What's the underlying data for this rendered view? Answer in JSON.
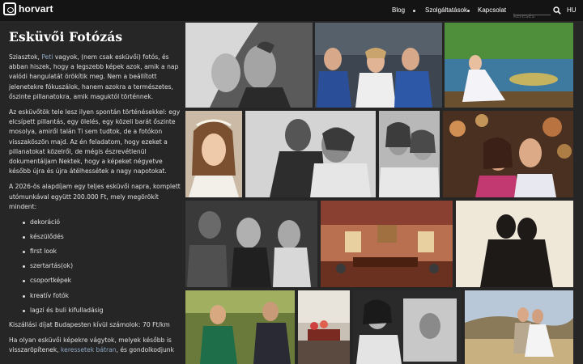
{
  "header": {
    "logo_text": "horvart",
    "nav": {
      "blog": "Blog",
      "services": "Szolgáltatások",
      "contact": "Kapcsolat"
    },
    "search_placeholder": "keresés",
    "search_icon": "search-icon",
    "language": "HU"
  },
  "page": {
    "title": "Esküvői Fotózás",
    "intro_before": "Sziasztok, ",
    "intro_link": "Peti",
    "intro_after": " vagyok, (nem csak esküvői) fotós, és abban hiszek, hogy a legszebb képek azok, amik a nap valódi hangulatát örökítik meg. Nem a beállított jelenetekre fókuszálok, hanem azokra a természetes, őszinte pillanatokra, amik maguktól történnek.",
    "paragraph2": "Az esküvőtök tele lesz ilyen spontán történésekkel: egy elcsípett pillantás, egy ölelés, egy közeli barát őszinte mosolya, amiről talán Ti sem tudtok, de a fotókon visszaköszön majd. Az én feladatom, hogy ezeket a pillanatokat közelről, de mégis észrevétlenül dokumentáljam Nektek, hogy a képeket négyetve később újra és újra átélhessétek a nagy napotokat.",
    "paragraph3": "A 2026-ös alapdíjam egy teljes esküvői napra, komplett utómunkával együtt 200.000 Ft, mely megörökít mindent:",
    "list": [
      "dekoráció",
      "készülődés",
      "first look",
      "szertartás(ok)",
      "csoportképek",
      "kreatív fotók",
      "lagzi és buli kifulladásig"
    ],
    "travel_fee": "Kiszállási díjat Budapesten kívül számolok: 70 Ft/km",
    "closing_before": "Ha olyan esküvői képekre vágytok, melyek később is visszaröpítenek, ",
    "closing_link": "keressetek bátran",
    "closing_after": ", és gondolkodjunk"
  },
  "gallery": [
    {
      "name": "photo-couple-veil",
      "style": "bw"
    },
    {
      "name": "photo-bridesmaids",
      "style": "color"
    },
    {
      "name": "photo-bride-lake",
      "style": "color"
    },
    {
      "name": "photo-bride-portrait",
      "style": "color"
    },
    {
      "name": "photo-couple-embrace",
      "style": "bw"
    },
    {
      "name": "photo-two-women",
      "style": "bw"
    },
    {
      "name": "photo-couple-kiss-lights",
      "style": "color"
    },
    {
      "name": "photo-guests-bw",
      "style": "bw"
    },
    {
      "name": "photo-ceremony-hall",
      "style": "color"
    },
    {
      "name": "photo-couple-silhouette",
      "style": "color"
    },
    {
      "name": "photo-guests-toast",
      "style": "color"
    },
    {
      "name": "photo-cake-table",
      "style": "color"
    },
    {
      "name": "photo-bride-mirror",
      "style": "bw"
    },
    {
      "name": "photo-couple-field",
      "style": "color"
    }
  ],
  "colors": {
    "background": "#262626",
    "topbar": "#141414",
    "link": "#8fa9c4"
  }
}
